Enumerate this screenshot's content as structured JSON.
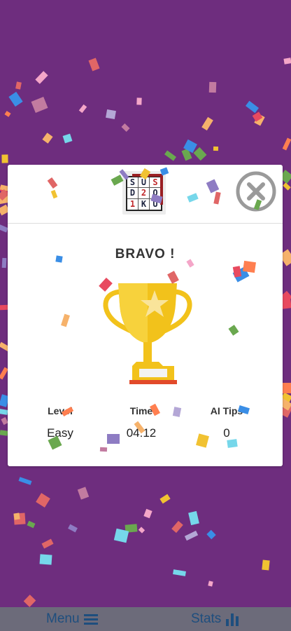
{
  "modal": {
    "title": "BRAVO !",
    "logo_letters": [
      "S",
      "U",
      "S",
      "D",
      "2",
      "O",
      "1",
      "K",
      "U"
    ],
    "stats": [
      {
        "label": "Level",
        "value": "Easy"
      },
      {
        "label": "Time",
        "value": "04:12"
      },
      {
        "label": "AI Tips",
        "value": "0"
      }
    ]
  },
  "bottom_bar": {
    "menu_label": "Menu",
    "stats_label": "Stats"
  },
  "colors": {
    "background": "#6e2d7e",
    "trophy_gold": "#f2c21b",
    "trophy_base": "#e24a2a",
    "close_icon": "#9a9a9a",
    "bar_text": "#1e4e7e"
  }
}
